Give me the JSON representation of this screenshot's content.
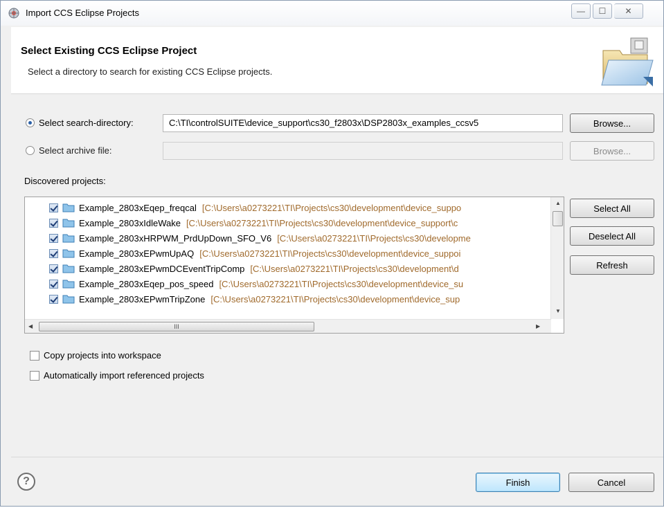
{
  "window": {
    "title": "Import CCS Eclipse Projects",
    "minimize_glyph": "—",
    "maximize_glyph": "☐",
    "close_glyph": "✕"
  },
  "banner": {
    "title": "Select Existing CCS Eclipse Project",
    "description": "Select a directory to search for existing CCS Eclipse projects."
  },
  "source": {
    "search_dir_label": "Select search-directory:",
    "search_dir_value": "C:\\TI\\controlSUITE\\device_support\\cs30_f2803x\\DSP2803x_examples_ccsv5",
    "search_dir_selected": true,
    "browse_label": "Browse...",
    "archive_label": "Select archive file:",
    "archive_value": "",
    "archive_browse_label": "Browse..."
  },
  "projects": {
    "label": "Discovered projects:",
    "items": [
      {
        "name": "Example_2803xEqep_freqcal",
        "path": "[C:\\Users\\a0273221\\TI\\Projects\\cs30\\development\\device_suppo",
        "checked": true
      },
      {
        "name": "Example_2803xIdleWake",
        "path": "[C:\\Users\\a0273221\\TI\\Projects\\cs30\\development\\device_support\\c",
        "checked": true
      },
      {
        "name": "Example_2803xHRPWM_PrdUpDown_SFO_V6",
        "path": "[C:\\Users\\a0273221\\TI\\Projects\\cs30\\developme",
        "checked": true
      },
      {
        "name": "Example_2803xEPwmUpAQ",
        "path": "[C:\\Users\\a0273221\\TI\\Projects\\cs30\\development\\device_suppoi",
        "checked": true
      },
      {
        "name": "Example_2803xEPwmDCEventTripComp",
        "path": "[C:\\Users\\a0273221\\TI\\Projects\\cs30\\development\\d",
        "checked": true
      },
      {
        "name": "Example_2803xEqep_pos_speed",
        "path": "[C:\\Users\\a0273221\\TI\\Projects\\cs30\\development\\device_su",
        "checked": true
      },
      {
        "name": "Example_2803xEPwmTripZone",
        "path": "[C:\\Users\\a0273221\\TI\\Projects\\cs30\\development\\device_sup",
        "checked": true
      }
    ],
    "select_all_label": "Select All",
    "deselect_all_label": "Deselect All",
    "refresh_label": "Refresh",
    "hscroll_grip": "III"
  },
  "options": {
    "copy_label": "Copy projects into workspace",
    "copy_checked": false,
    "auto_import_label": "Automatically import referenced projects",
    "auto_import_checked": false
  },
  "footer": {
    "help_glyph": "?",
    "finish_label": "Finish",
    "cancel_label": "Cancel"
  }
}
